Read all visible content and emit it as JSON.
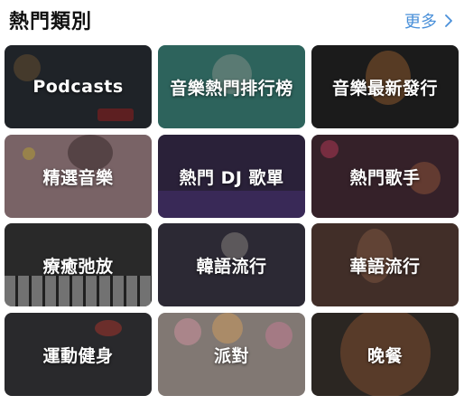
{
  "header": {
    "title": "熱門類別",
    "more_label": "更多",
    "more_icon": "chevron-right-icon",
    "accent": "#4a90d9"
  },
  "categories": [
    {
      "label": "Podcasts",
      "bg": "#2b3138"
    },
    {
      "label": "音樂熱門排行榜",
      "bg": "#3f8a80"
    },
    {
      "label": "音樂最新發行",
      "bg": "#262626"
    },
    {
      "label": "精選音樂",
      "bg": "#a8898e"
    },
    {
      "label": "熱門 DJ 歌單",
      "bg": "#3b2f4f"
    },
    {
      "label": "熱門歌手",
      "bg": "#4a2f3a"
    },
    {
      "label": "療癒弛放",
      "bg": "#3a3a3a"
    },
    {
      "label": "韓語流行",
      "bg": "#3d3a48"
    },
    {
      "label": "華語流行",
      "bg": "#5a4138"
    },
    {
      "label": "運動健身",
      "bg": "#3a3a3d"
    },
    {
      "label": "派對",
      "bg": "#b3a7a0"
    },
    {
      "label": "晚餐",
      "bg": "#3c3530"
    }
  ]
}
